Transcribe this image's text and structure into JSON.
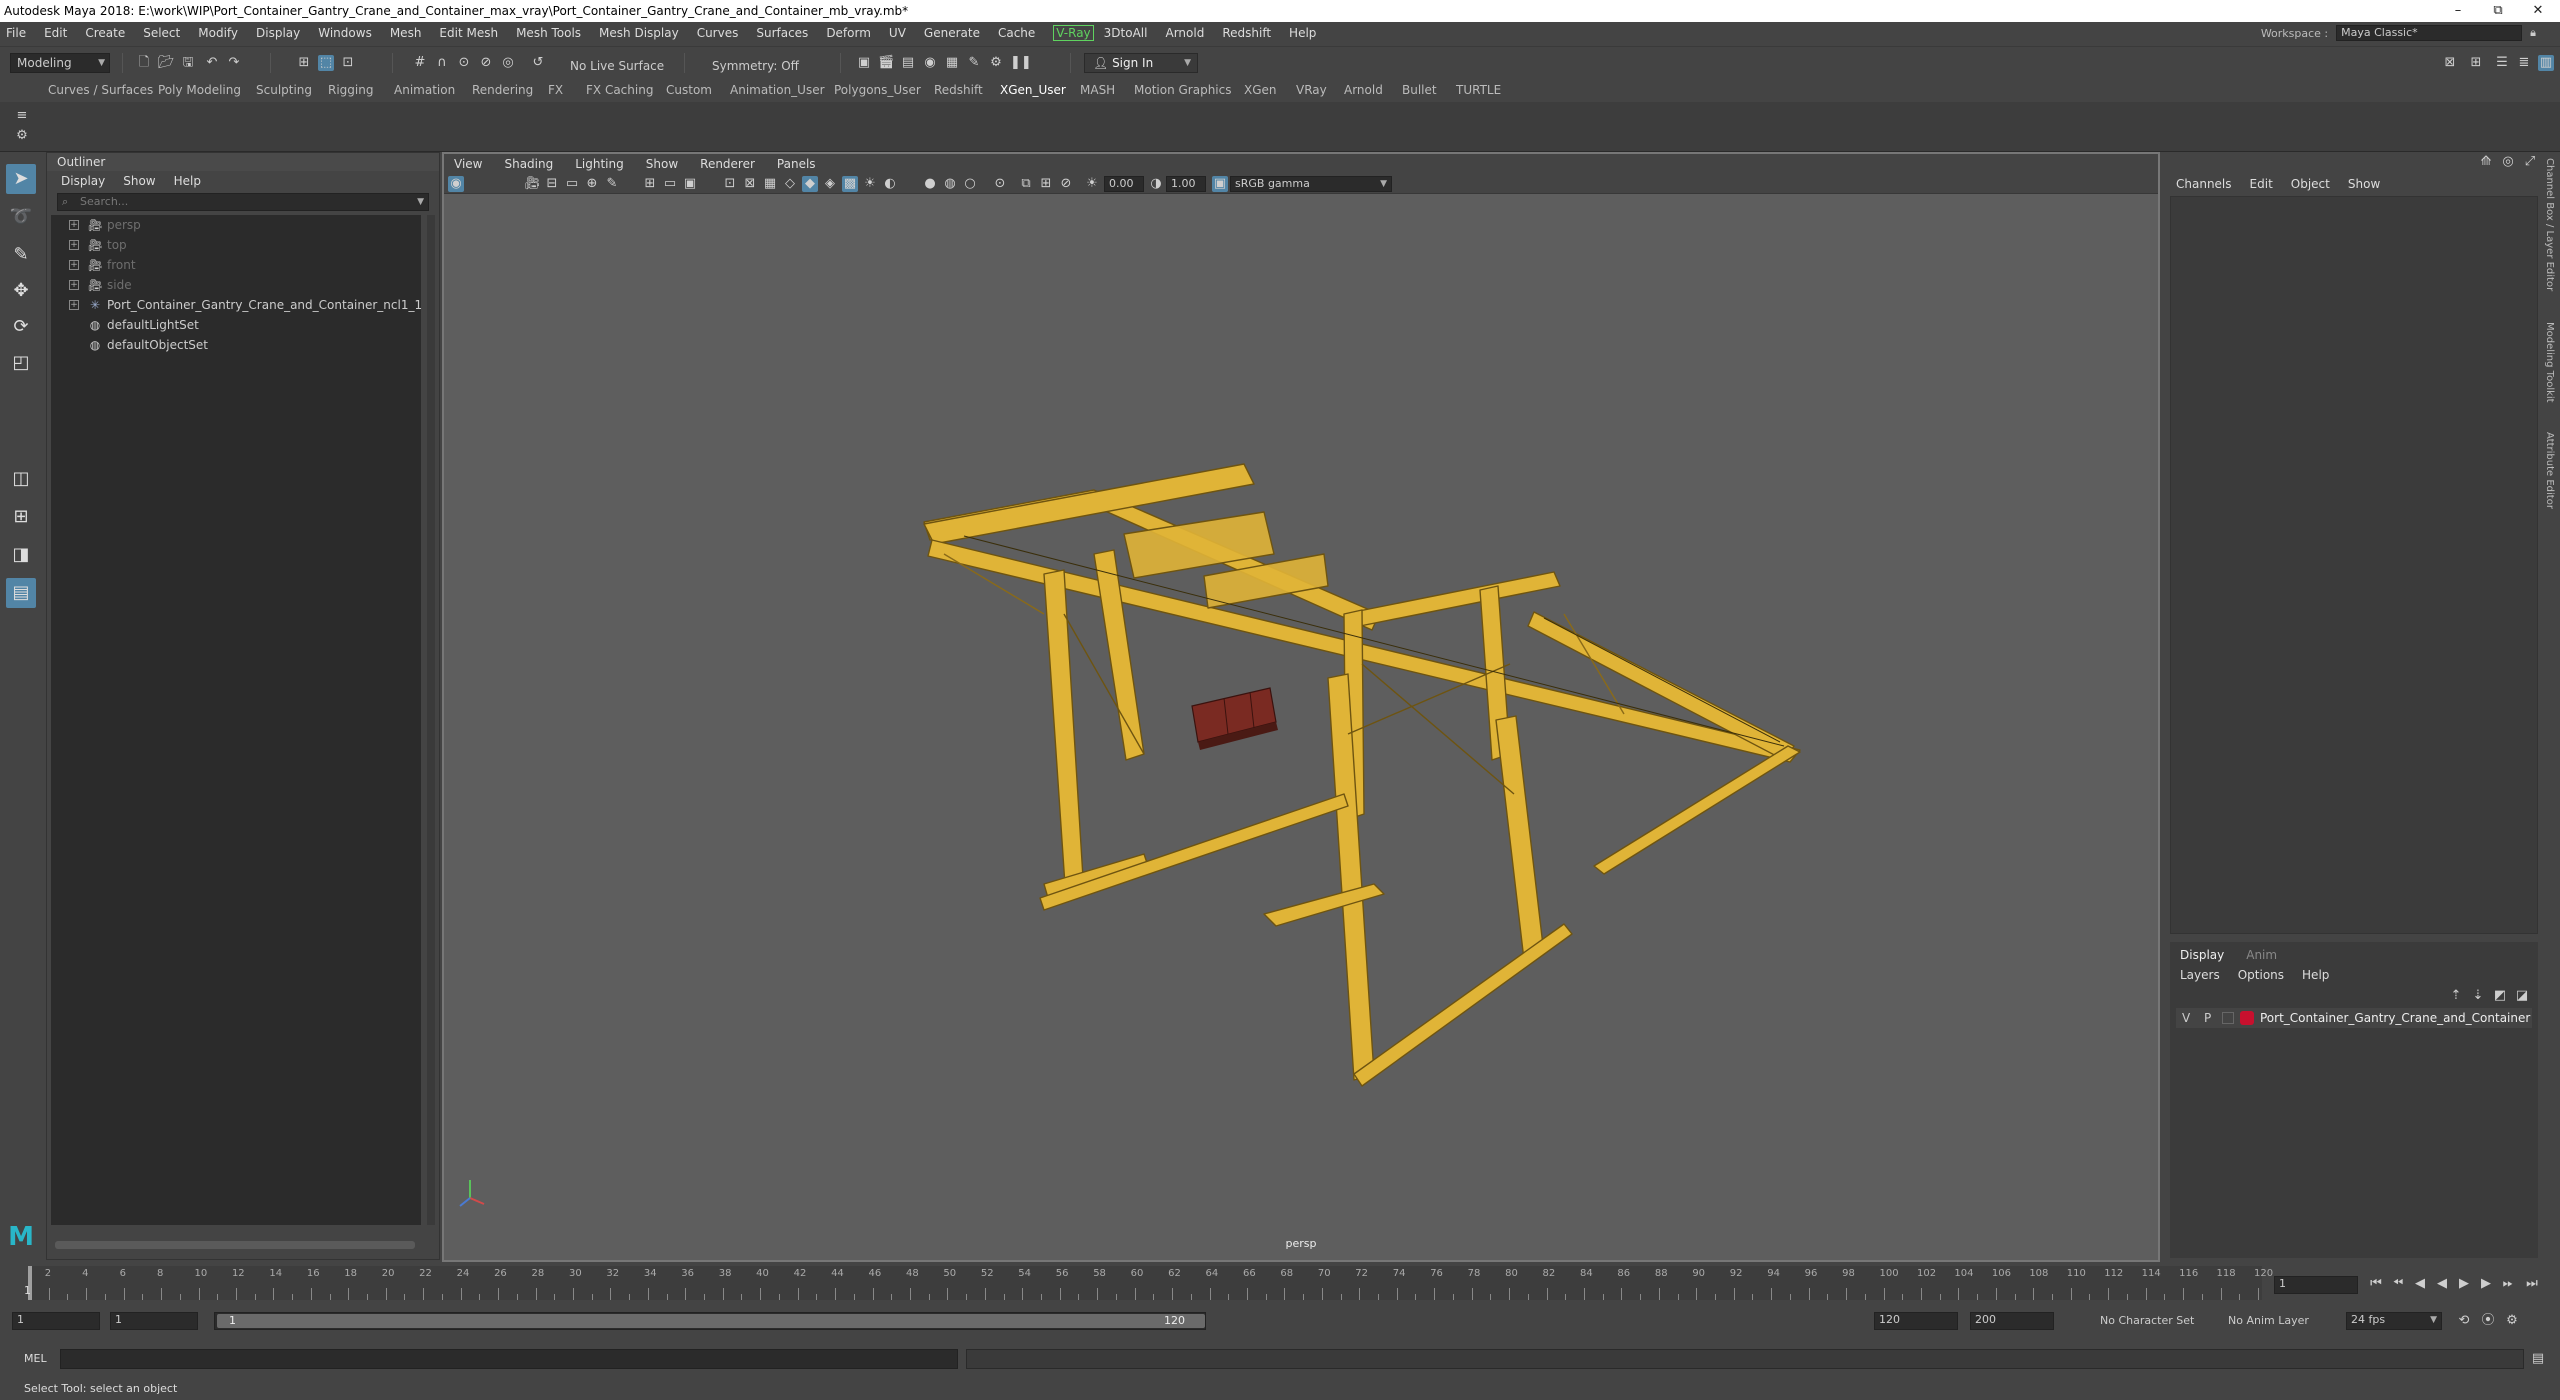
{
  "window": {
    "title": "Autodesk Maya 2018: E:\\work\\WIP\\Port_Container_Gantry_Crane_and_Container_max_vray\\Port_Container_Gantry_Crane_and_Container_mb_vray.mb*",
    "minimize": "–",
    "restore": "⧉",
    "close": "✕"
  },
  "menubar": {
    "items": [
      "File",
      "Edit",
      "Create",
      "Select",
      "Modify",
      "Display",
      "Windows",
      "Mesh",
      "Edit Mesh",
      "Mesh Tools",
      "Mesh Display",
      "Curves",
      "Surfaces",
      "Deform",
      "UV",
      "Generate",
      "Cache",
      "V-Ray",
      "3DtoAll",
      "Arnold",
      "Redshift",
      "Help"
    ],
    "workspace_label": "Workspace :",
    "workspace_value": "Maya Classic*"
  },
  "statusline": {
    "mode": "Modeling",
    "live_surface": "No Live Surface",
    "symmetry": "Symmetry: Off",
    "sign_in": "Sign In"
  },
  "shelf": {
    "tabs": [
      "Curves / Surfaces",
      "Poly Modeling",
      "Sculpting",
      "Rigging",
      "Animation",
      "Rendering",
      "FX",
      "FX Caching",
      "Custom",
      "Animation_User",
      "Polygons_User",
      "Redshift",
      "XGen_User",
      "MASH",
      "Motion Graphics",
      "XGen",
      "VRay",
      "Arnold",
      "Bullet",
      "TURTLE"
    ],
    "active": "XGen_User"
  },
  "outliner": {
    "title": "Outliner",
    "menu": [
      "Display",
      "Show",
      "Help"
    ],
    "search_placeholder": "Search...",
    "items": [
      {
        "label": "persp",
        "icon": "camera-icon",
        "dim": true,
        "expandable": true
      },
      {
        "label": "top",
        "icon": "camera-icon",
        "dim": true,
        "expandable": true
      },
      {
        "label": "front",
        "icon": "camera-icon",
        "dim": true,
        "expandable": true
      },
      {
        "label": "side",
        "icon": "camera-icon",
        "dim": true,
        "expandable": true
      },
      {
        "label": "Port_Container_Gantry_Crane_and_Container_ncl1_1",
        "icon": "group-icon",
        "dim": false,
        "expandable": true
      },
      {
        "label": "defaultLightSet",
        "icon": "set-icon",
        "dim": false,
        "expandable": false
      },
      {
        "label": "defaultObjectSet",
        "icon": "set-icon",
        "dim": false,
        "expandable": false
      }
    ]
  },
  "viewport": {
    "menu": [
      "View",
      "Shading",
      "Lighting",
      "Show",
      "Renderer",
      "Panels"
    ],
    "exposure": "0.00",
    "gamma": "1.00",
    "color_space": "sRGB gamma",
    "camera": "persp",
    "model_color": "#e0b437",
    "container_color": "#7a2a22"
  },
  "channelbox": {
    "menu": [
      "Channels",
      "Edit",
      "Object",
      "Show"
    ],
    "layer_tabs": [
      "Display",
      "Anim"
    ],
    "layer_menu": [
      "Layers",
      "Options",
      "Help"
    ],
    "layer": {
      "v": "V",
      "p": "P",
      "name": "Port_Container_Gantry_Crane_and_Container",
      "color": "#c8102e"
    },
    "side_tabs": [
      "Channel Box / Layer Editor",
      "Modeling Toolkit",
      "Attribute Editor"
    ]
  },
  "timeslider": {
    "labels": [
      "2",
      "4",
      "6",
      "8",
      "10",
      "12",
      "14",
      "16",
      "18",
      "20",
      "22",
      "24",
      "26",
      "28",
      "30",
      "32",
      "34",
      "36",
      "38",
      "40",
      "42",
      "44",
      "46",
      "48",
      "50",
      "52",
      "54",
      "56",
      "58",
      "60",
      "62",
      "64",
      "66",
      "68",
      "70",
      "72",
      "74",
      "76",
      "78",
      "80",
      "82",
      "84",
      "86",
      "88",
      "90",
      "92",
      "94",
      "96",
      "98",
      "100",
      "102",
      "104",
      "106",
      "108",
      "110",
      "112",
      "114",
      "116",
      "118",
      "120"
    ],
    "current_frame": "1",
    "playhead": "1"
  },
  "rangeslider": {
    "start": "1",
    "anim_start": "1",
    "range_start": "1",
    "range_end": "120",
    "end": "120",
    "anim_end": "200",
    "character_set": "No Character Set",
    "anim_layer": "No Anim Layer",
    "fps": "24 fps"
  },
  "cmdline": {
    "label": "MEL"
  },
  "helpline": {
    "text": "Select Tool: select an object"
  }
}
